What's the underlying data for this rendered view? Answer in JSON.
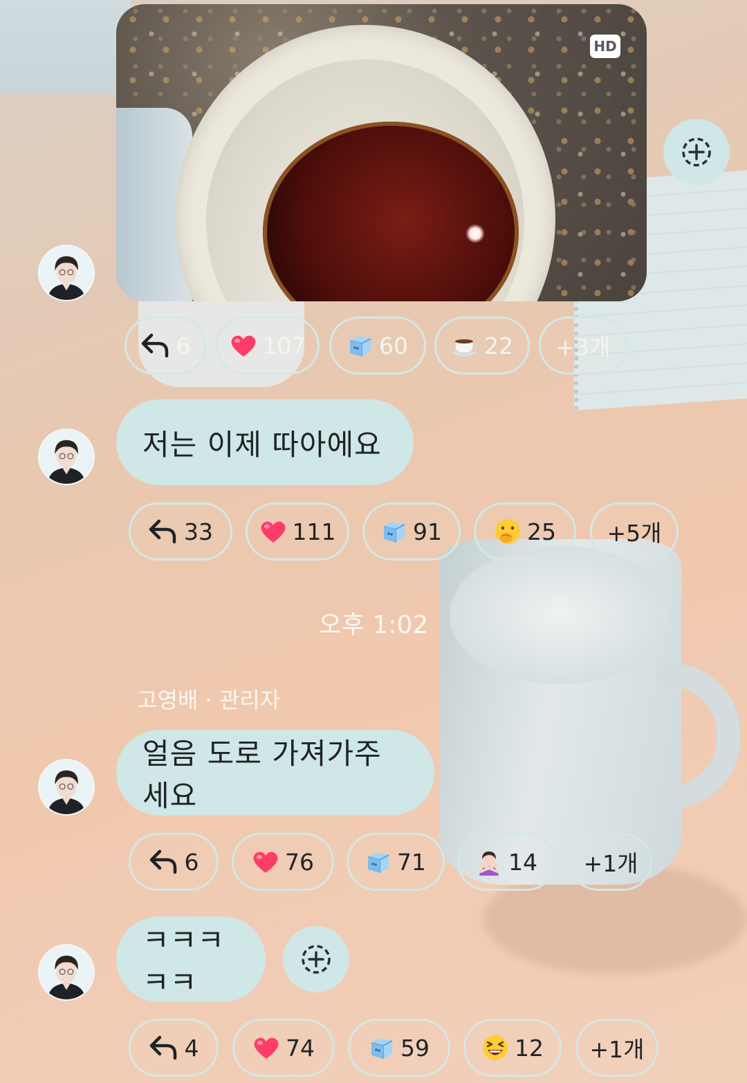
{
  "messages": [
    {
      "type": "photo",
      "badge": "HD",
      "reactions": [
        {
          "icon": "reply-icon",
          "count": "6"
        },
        {
          "icon": "heart-icon",
          "count": "107"
        },
        {
          "icon": "ice-cube-icon",
          "count": "60"
        },
        {
          "icon": "coffee-icon",
          "count": "22"
        }
      ],
      "more": "+3개"
    },
    {
      "type": "text",
      "text": "저는 이제 따아에요",
      "reactions": [
        {
          "icon": "reply-icon",
          "count": "33"
        },
        {
          "icon": "heart-icon",
          "count": "111"
        },
        {
          "icon": "ice-cube-icon",
          "count": "91"
        },
        {
          "icon": "shushing-face-icon",
          "count": "25"
        }
      ],
      "more": "+5개"
    },
    {
      "type": "text",
      "text": "얼음 도로 가져가주세요",
      "reactions": [
        {
          "icon": "reply-icon",
          "count": "6"
        },
        {
          "icon": "heart-icon",
          "count": "76"
        },
        {
          "icon": "ice-cube-icon",
          "count": "71"
        },
        {
          "icon": "person-gesturing-no-icon",
          "count": "14"
        }
      ],
      "more": "+1개"
    },
    {
      "type": "text",
      "text": "ㅋㅋㅋㅋㅋ",
      "reactions": [
        {
          "icon": "reply-icon",
          "count": "4"
        },
        {
          "icon": "heart-icon",
          "count": "74"
        },
        {
          "icon": "ice-cube-icon",
          "count": "59"
        },
        {
          "icon": "laughing-face-icon",
          "count": "12"
        }
      ],
      "more": "+1개"
    }
  ],
  "timestamp": "오후 1:02",
  "sender": "고영배 · 관리자",
  "colors": {
    "bubble": "#cfe7e6",
    "chip_border": "#d3e8e6",
    "text_dark": "#1f2326",
    "text_light": "#fbf8f4"
  }
}
